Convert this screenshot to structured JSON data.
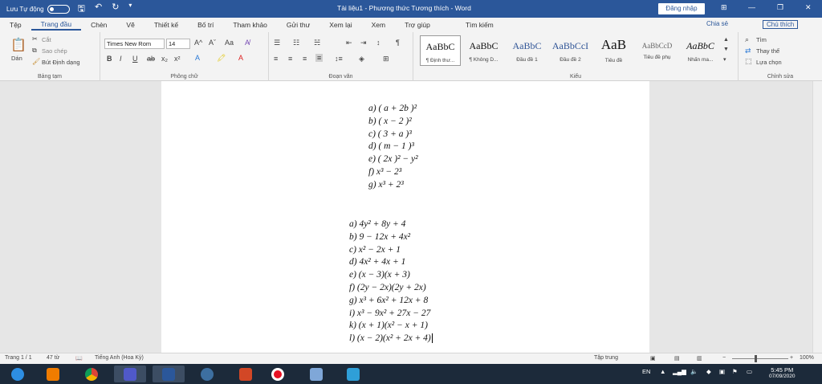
{
  "titlebar": {
    "autosave_label": "Lưu Tự động",
    "document_title": "Tài liệu1 - Phương thức Tương thích - Word",
    "login_button": "Đăng nhập"
  },
  "tabs": [
    "Tệp",
    "Trang đầu",
    "Chèn",
    "Vẽ",
    "Thiết kế",
    "Bố trí",
    "Tham khảo",
    "Gửi thư",
    "Xem lại",
    "Xem",
    "Trợ giúp"
  ],
  "search_tab": "Tìm kiếm",
  "share": "Chia sẻ",
  "comments": "Chú thích",
  "ribbon": {
    "clipboard": {
      "paste": "Dán",
      "cut": "Cắt",
      "copy": "Sao chép",
      "format_painter": "Bút Định dạng",
      "label": "Bảng tạm"
    },
    "font": {
      "name": "Times New Rom",
      "size": "14",
      "label": "Phông chữ"
    },
    "paragraph": {
      "label": "Đoạn văn"
    },
    "styles": {
      "label": "Kiểu",
      "items": [
        {
          "sample": "AaBbC",
          "name": "¶ Định thư..."
        },
        {
          "sample": "AaBbC",
          "name": "¶ Không D..."
        },
        {
          "sample": "AaBbC",
          "name": "Đầu đề 1"
        },
        {
          "sample": "AaBbCcI",
          "name": "Đầu đề 2"
        },
        {
          "sample": "AaB",
          "name": "Tiêu đề"
        },
        {
          "sample": "AaBbCcD",
          "name": "Tiêu đề phụ"
        },
        {
          "sample": "AaBbC",
          "name": "Nhấn ma..."
        }
      ]
    },
    "editing": {
      "find": "Tìm",
      "replace": "Thay thế",
      "select": "Lựa chọn",
      "label": "Chỉnh sửa"
    }
  },
  "document": {
    "list1": [
      "a) ( a + 2b )²",
      "b) ( x − 2 )²",
      "c) ( 3 + a )³",
      "d) ( m − 1 )³",
      "e) ( 2x )² − y²",
      "f) x³ − 2³",
      "g) x³ + 2³"
    ],
    "list2": [
      "a) 4y² + 8y + 4",
      "b) 9 − 12x + 4x²",
      "c) x² − 2x + 1",
      "d) 4x² + 4x + 1",
      "e) (x − 3)(x + 3)",
      "f) (2y − 2x)(2y + 2x)",
      "g) x³ + 6x² + 12x + 8",
      "i) x³ − 9x² + 27x − 27",
      "k) (x + 1)(x² − x + 1)",
      "l) (x − 2)(x² + 2x + 4)"
    ]
  },
  "status": {
    "page": "Trang 1 / 1",
    "words": "47 từ",
    "language": "Tiếng Anh (Hoa Kỳ)",
    "focus": "Tập trung",
    "zoom": "100%"
  },
  "taskbar": {
    "lang": "EN",
    "time": "5:45 PM",
    "date": "07/09/2020"
  },
  "colors": {
    "titlebar": "#2b579a",
    "taskbar": "#1c2a3a"
  }
}
